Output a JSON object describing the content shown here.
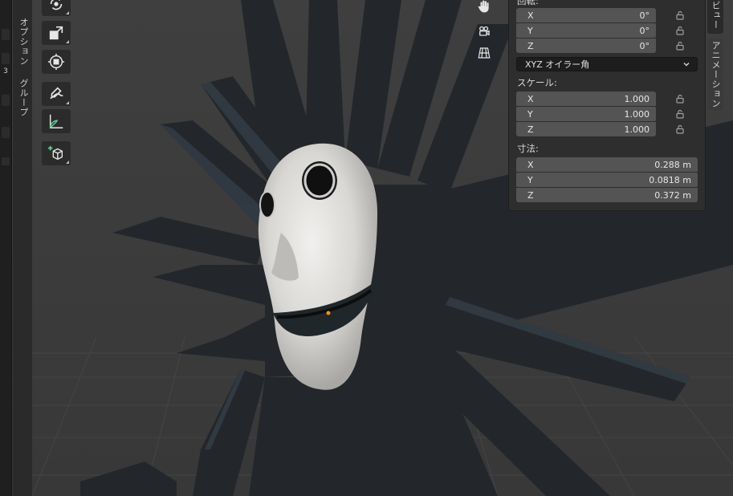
{
  "left_tabs": {
    "option": "オプション",
    "group": "グループ"
  },
  "left_strip_number": "3",
  "toolbar": {
    "tools": [
      {
        "icon": "rotate-icon"
      },
      {
        "icon": "scale-icon"
      },
      {
        "icon": "transform-icon"
      },
      {
        "icon": "annotate-icon"
      },
      {
        "icon": "measure-icon"
      },
      {
        "icon": "add-cube-icon"
      }
    ]
  },
  "nav_gizmo": {
    "icons": [
      "hand-pan-icon",
      "camera-icon",
      "grid-icon"
    ]
  },
  "transform_panel": {
    "rotation_label": "回転:",
    "rotation": [
      {
        "axis": "X",
        "value": "0°"
      },
      {
        "axis": "Y",
        "value": "0°"
      },
      {
        "axis": "Z",
        "value": "0°"
      }
    ],
    "rotation_mode": "XYZ オイラー角",
    "scale_label": "スケール:",
    "scale": [
      {
        "axis": "X",
        "value": "1.000"
      },
      {
        "axis": "Y",
        "value": "1.000"
      },
      {
        "axis": "Z",
        "value": "1.000"
      }
    ],
    "dimensions_label": "寸法:",
    "dimensions": [
      {
        "axis": "X",
        "value": "0.288 m"
      },
      {
        "axis": "Y",
        "value": "0.0818 m"
      },
      {
        "axis": "Z",
        "value": "0.372 m"
      }
    ]
  },
  "right_tabs": {
    "view": "ビュー",
    "animation": "アニメーション"
  },
  "colors": {
    "background": "#3d3d3d",
    "panel": "#2e2e2e",
    "field": "#545454",
    "origin_dot": "#ff8a1c"
  }
}
